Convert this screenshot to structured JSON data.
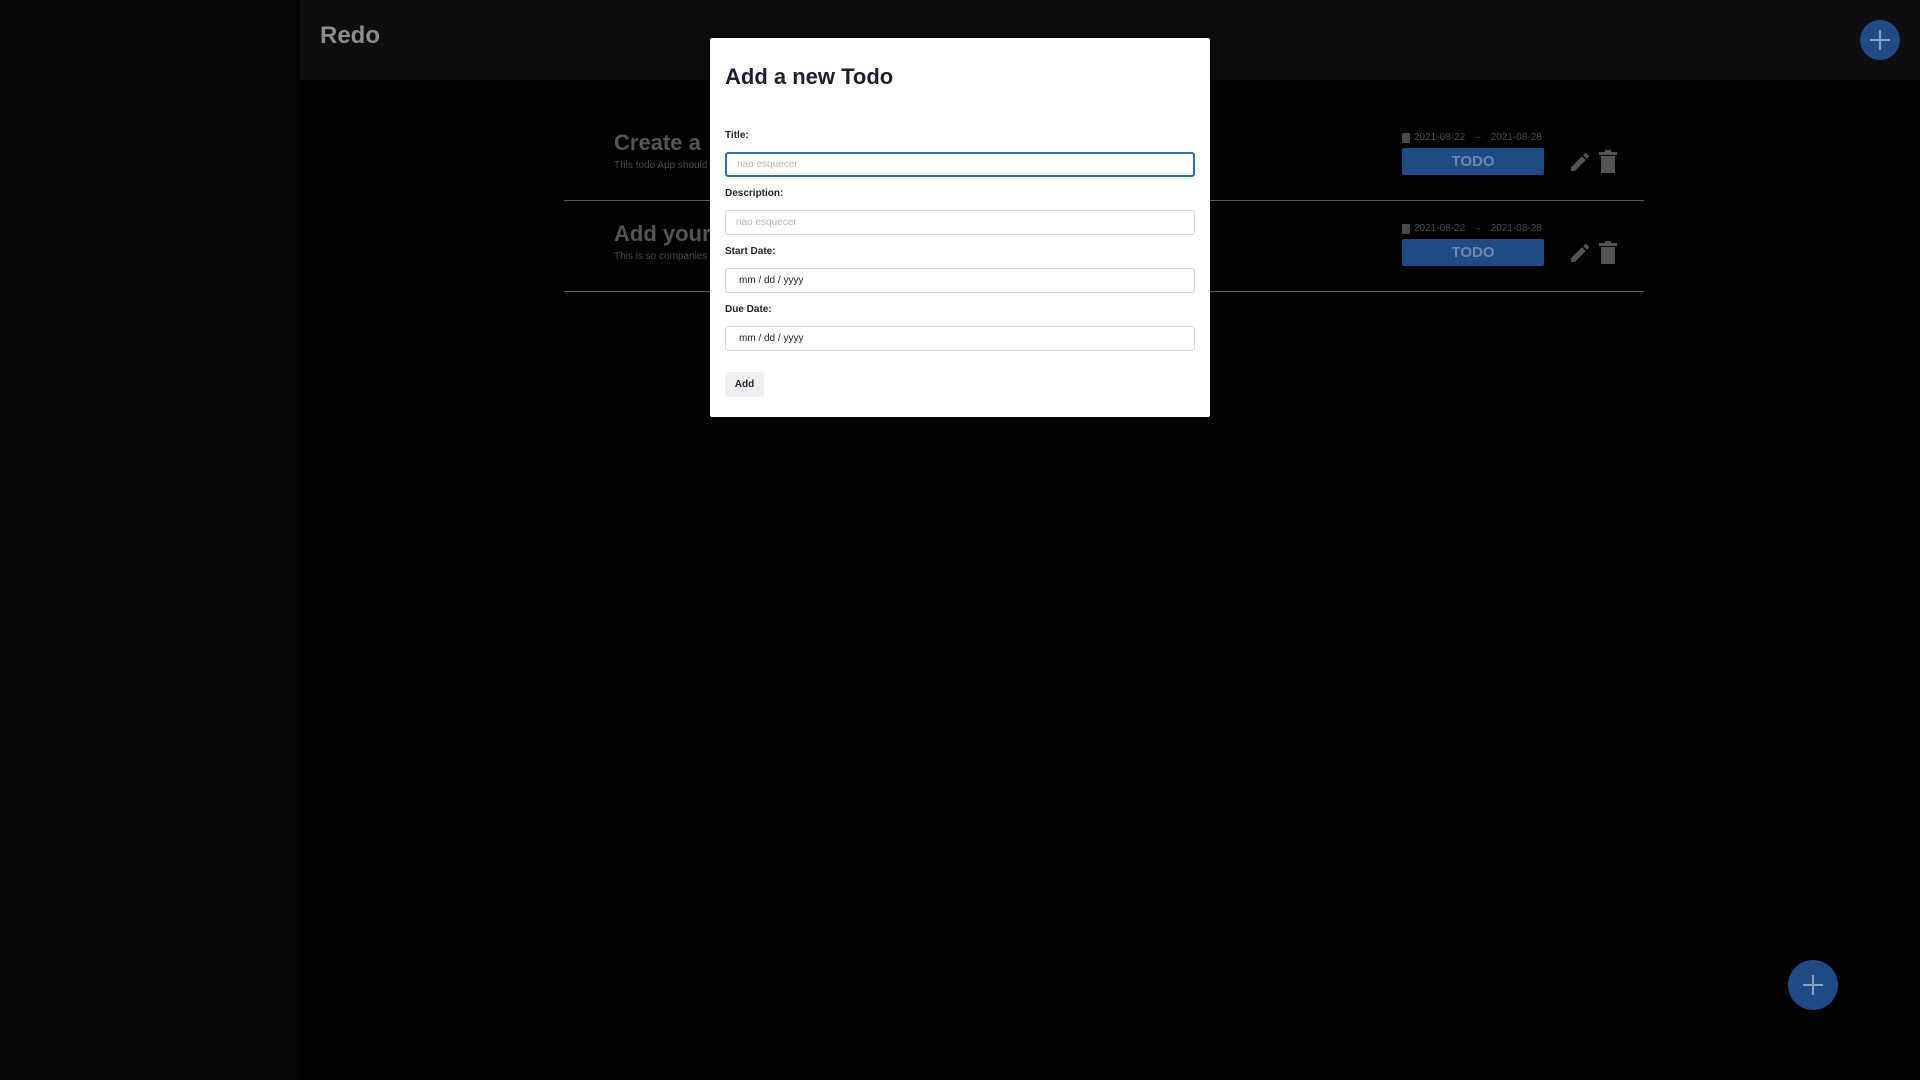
{
  "app": {
    "title": "Redo"
  },
  "todos": [
    {
      "title": "Create a",
      "description": "This todo App should",
      "start_date": "2021-08-22",
      "date_separator": "–",
      "due_date": "2021-08-28",
      "status": "TODO"
    },
    {
      "title": "Add your",
      "description": "This is so companies",
      "start_date": "2021-08-22",
      "date_separator": "–",
      "due_date": "2021-08-28",
      "status": "TODO"
    }
  ],
  "modal": {
    "title": "Add a new Todo",
    "fields": {
      "title_label": "Title:",
      "title_placeholder": "nao esquecer",
      "description_label": "Description:",
      "description_placeholder": "nao esquecer",
      "start_date_label": "Start Date:",
      "start_date_value": "mm / dd / yyyy",
      "due_date_label": "Due Date:",
      "due_date_value": "mm / dd / yyyy"
    },
    "add_label": "Add"
  },
  "icons": {
    "fab": "plus-icon",
    "edit": "pencil-icon",
    "delete": "trash-icon",
    "date": "calendar-icon"
  },
  "colors": {
    "accent": "#1f4a86",
    "focus": "#2a6db5"
  }
}
